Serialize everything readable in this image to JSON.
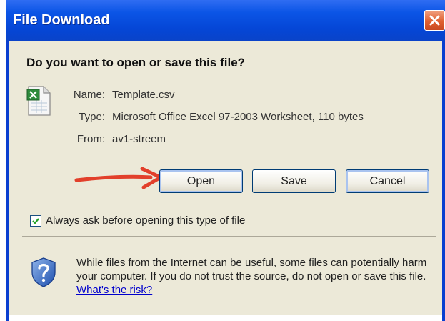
{
  "window": {
    "title": "File Download"
  },
  "dialog": {
    "question": "Do you want to open or save this file?",
    "file": {
      "name_label": "Name:",
      "name": "Template.csv",
      "type_label": "Type:",
      "type": "Microsoft Office Excel 97-2003 Worksheet, 110 bytes",
      "from_label": "From:",
      "from": "av1-streem"
    },
    "buttons": {
      "open": "Open",
      "save": "Save",
      "cancel": "Cancel"
    },
    "always_ask": {
      "label": "Always ask before opening this type of file",
      "checked": true
    },
    "warning": {
      "text": "While files from the Internet can be useful, some files can potentially harm your computer. If you do not trust the source, do not open or save this file.",
      "link": "What's the risk?"
    }
  },
  "colors": {
    "titlebar": "#0b55e6",
    "dialog_bg": "#ece9d8",
    "arrow": "#e2402b",
    "link": "#0000cc"
  },
  "icons": [
    "excel-file-icon",
    "close-icon",
    "checkmark-icon",
    "security-shield-icon",
    "arrow-annotation"
  ]
}
